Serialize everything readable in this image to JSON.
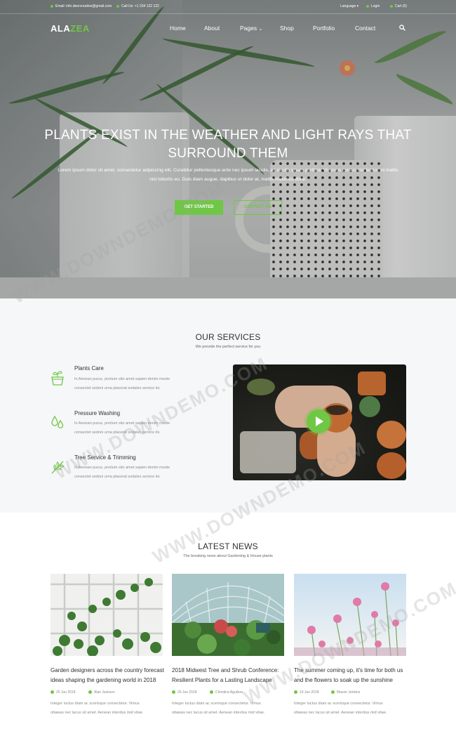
{
  "topbar": {
    "email": "Email: info.deercreative@gmail.com",
    "phone": "Call Us: +1 234 122 122",
    "language": "Language",
    "login": "Login",
    "cart": "Cart (0)"
  },
  "brand": {
    "part1": "ALA",
    "part2": "ZEA"
  },
  "nav": {
    "items": [
      "Home",
      "About",
      "Pages",
      "Shop",
      "Portfolio",
      "Contact"
    ]
  },
  "hero": {
    "title_line1": "PLANTS EXIST IN THE WEATHER AND LIGHT RAYS THAT",
    "title_line2": "SURROUND THEM",
    "text_line1": "Lorem ipsum dolor sit amet, consectetur adipiscing elit. Curabitur pellentesque ante nec ipsum iaculis, ac iaculis ipsum porttitor. Vivamus cursus nisl lectus, id mattis",
    "text_line2": "nisl lobortis eu. Duis diam augue, dapibus ut dolor at, mattis maximus dolor.",
    "btn_primary": "GET STARTED",
    "btn_secondary": "CONTACT US"
  },
  "services": {
    "title": "OUR SERVICES",
    "subtitle": "We provide the perfect service for you",
    "items": [
      {
        "icon": "plant-pot-icon",
        "title": "Plants Care",
        "text_line1": "In Aenean purus, pretium sito amet sapien denim moste",
        "text_line2": "consectet sedoni urna placerat sodales service its."
      },
      {
        "icon": "water-drops-icon",
        "title": "Pressure Washing",
        "text_line1": "In Aenean purus, pretium sito amet sapien denim moste",
        "text_line2": "consectet sedoni urna placerat sodales service its."
      },
      {
        "icon": "leaf-branch-icon",
        "title": "Tree Service & Trimming",
        "text_line1": "In Aenean purus, pretium sito amet sapien denim moste",
        "text_line2": "consectet sedoni urna placerat sodales service its."
      }
    ]
  },
  "news": {
    "title": "LATEST NEWS",
    "subtitle": "The breaking news about Gardening & House plants",
    "posts": [
      {
        "title_line1": "Garden designers across the country forecast",
        "title_line2": "ideas shaping the gardening world in 2018",
        "date": "20 Jun 2018",
        "author": "Alan Jackson",
        "text_line1": "Integer luctus diam ac scerisque consectetur. Vimus",
        "text_line2": "ottawas nec lacus sit amet. Aenean interdus mid vitae."
      },
      {
        "title_line1": "2018 Midwest Tree and Shrub Conference:",
        "title_line2": "Resilient Plants for a Lasting Landscape",
        "date": "20 Jun 2018",
        "author": "Christina Aguilera",
        "text_line1": "Integer luctus diam ac scerisque consectetur. Vimus",
        "text_line2": "ottawas nec lacus sit amet. Aenean interdus mid vitae."
      },
      {
        "title_line1": "The summer coming up, it's time for both us",
        "title_line2": "and the flowers to soak up the sunshine",
        "date": "19 Jun 2018",
        "author": "Mason Jenkins",
        "text_line1": "Integer luctus diam ac scerisque consectetur. Vimus",
        "text_line2": "ottawas nec lacus sit amet. Aenean interdus mid vitae."
      }
    ]
  },
  "watermark": "WWW.DOWNDEMO.COM",
  "colors": {
    "accent": "#70c745",
    "heading": "#303030",
    "muted": "#8a8a8a",
    "section_bg": "#f6f7f8"
  }
}
